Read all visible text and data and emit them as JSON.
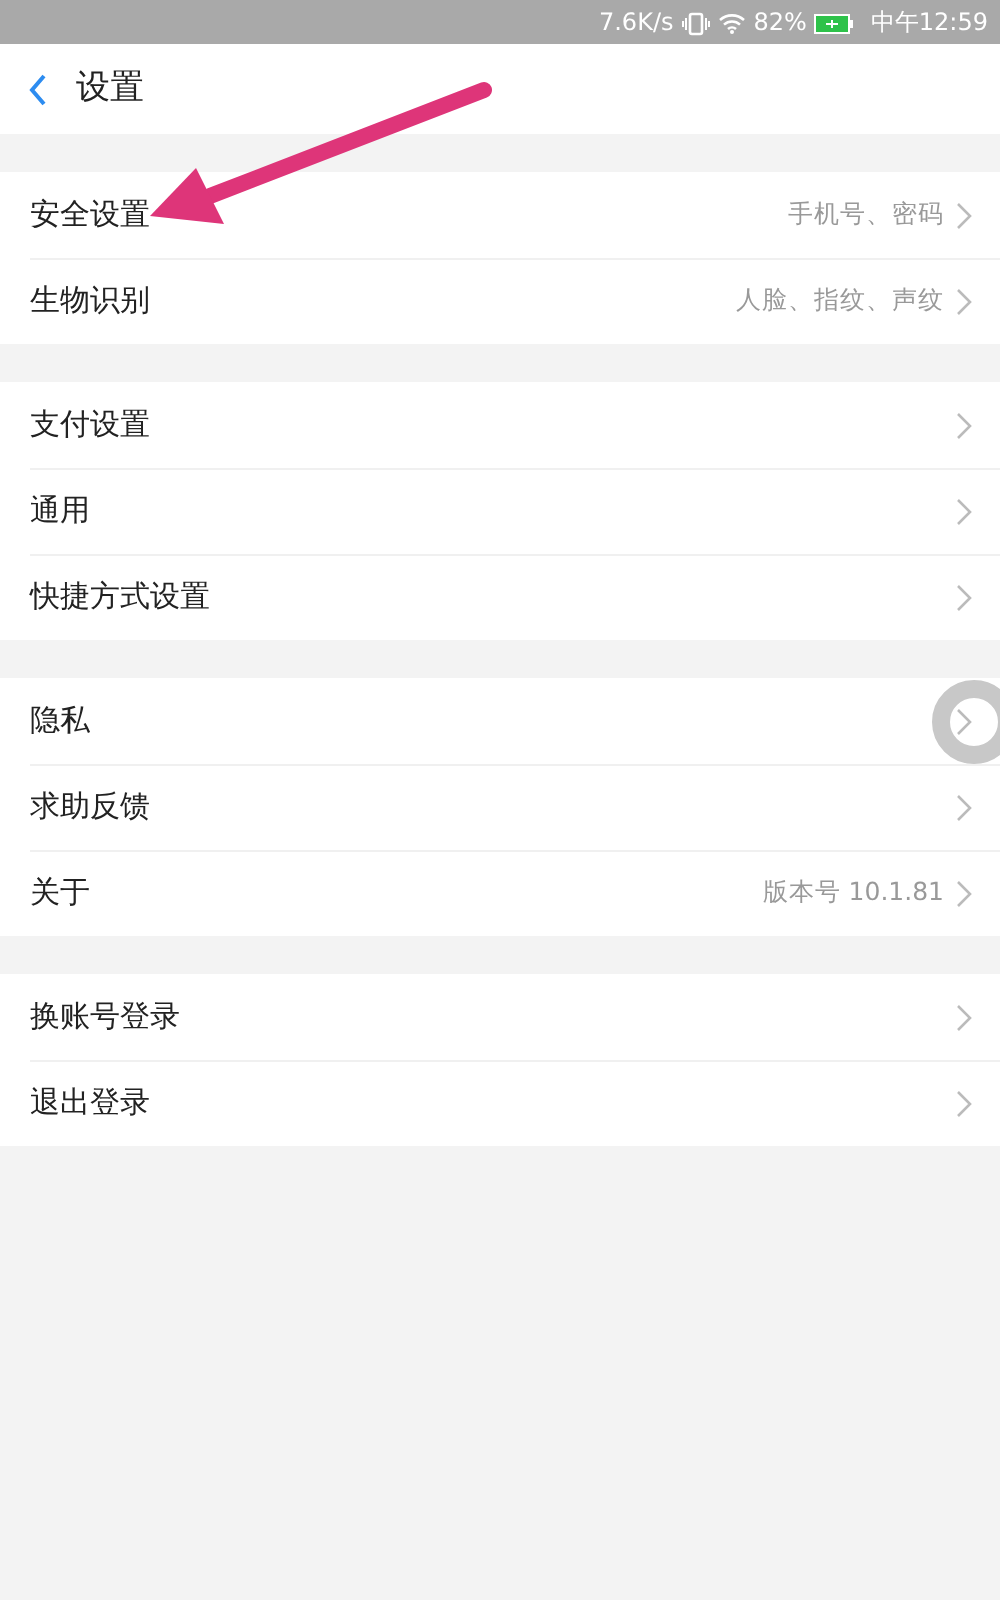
{
  "status_bar": {
    "network_speed": "7.6K/s",
    "battery": "82%",
    "time": "中午12:59"
  },
  "header": {
    "title": "设置"
  },
  "groups": [
    {
      "items": [
        {
          "label": "安全设置",
          "value": "手机号、密码"
        },
        {
          "label": "生物识别",
          "value": "人脸、指纹、声纹"
        }
      ]
    },
    {
      "items": [
        {
          "label": "支付设置"
        },
        {
          "label": "通用"
        },
        {
          "label": "快捷方式设置"
        }
      ]
    },
    {
      "items": [
        {
          "label": "隐私"
        },
        {
          "label": "求助反馈"
        },
        {
          "label": "关于",
          "value": "版本号 10.1.81"
        }
      ]
    },
    {
      "items": [
        {
          "label": "换账号登录"
        },
        {
          "label": "退出登录"
        }
      ]
    }
  ]
}
